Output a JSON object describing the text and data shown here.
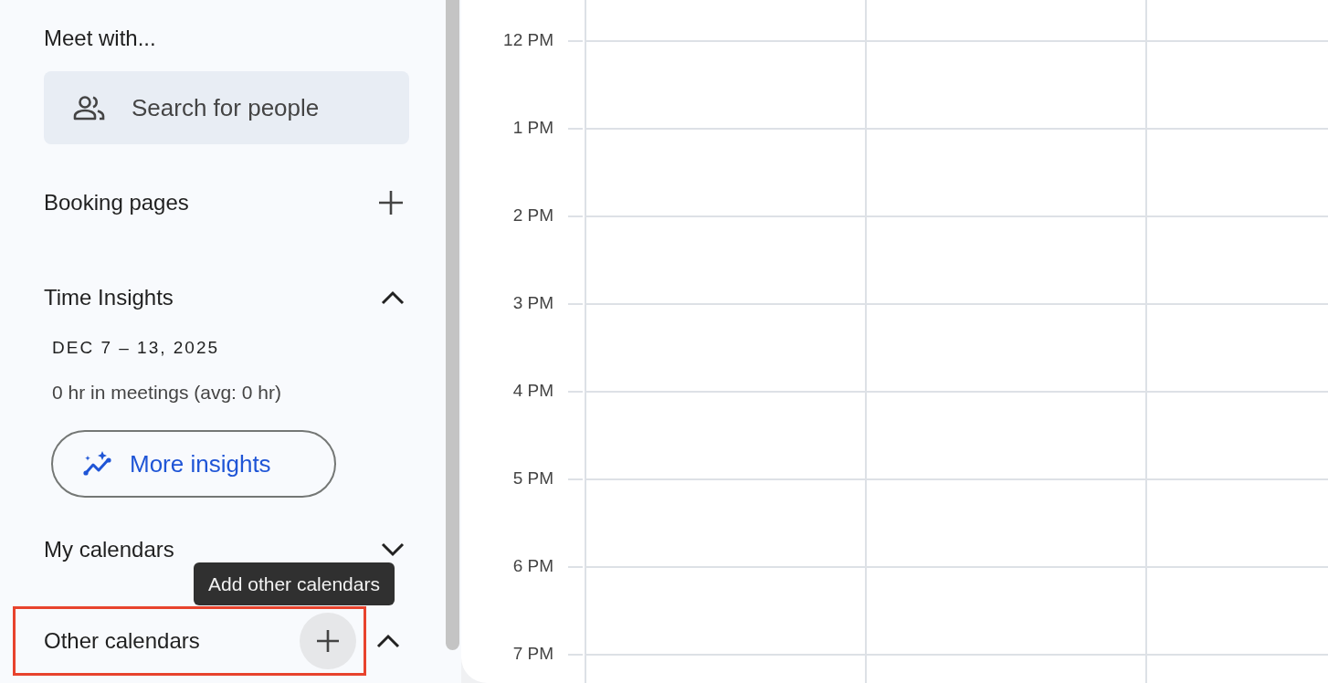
{
  "sidebar": {
    "sections": [
      {
        "kind": "search",
        "title": "Meet with...",
        "placeholder": "Search for people"
      },
      {
        "kind": "add",
        "title": "Booking pages"
      },
      {
        "kind": "insights",
        "title": "Time Insights",
        "expanded": true,
        "date_range": "DEC 7 – 13, 2025",
        "summary": "0 hr in meetings (avg: 0 hr)",
        "button": "More insights"
      },
      {
        "kind": "toggle",
        "title": "My calendars",
        "expanded": false
      },
      {
        "kind": "add_toggle",
        "title": "Other calendars",
        "expanded": true,
        "highlighted": true,
        "add_hovered": true,
        "tooltip": "Add other calendars"
      }
    ]
  },
  "calendar": {
    "hours": [
      "12 PM",
      "1 PM",
      "2 PM",
      "3 PM",
      "4 PM",
      "5 PM",
      "6 PM",
      "7 PM"
    ]
  }
}
